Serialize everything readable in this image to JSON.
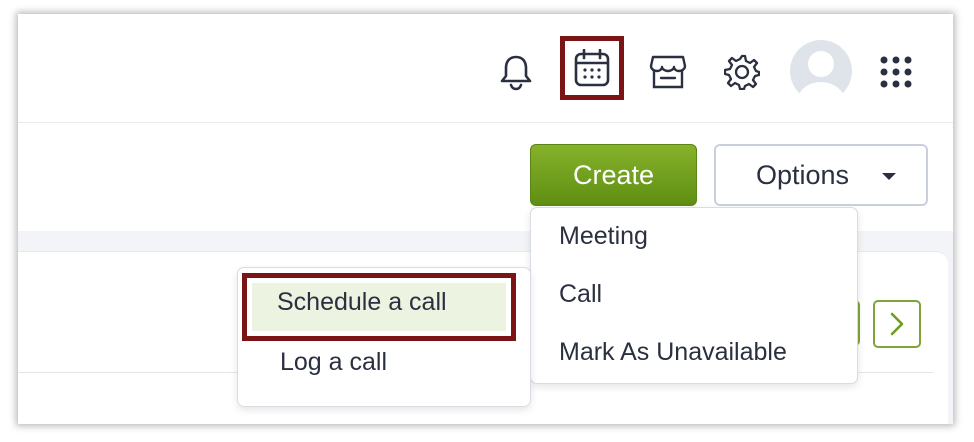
{
  "topbar": {
    "icons": [
      "bell-icon",
      "calendar-icon",
      "store-icon",
      "gear-icon",
      "avatar",
      "apps-grid-icon"
    ],
    "highlight_color": "#7b1414"
  },
  "actions": {
    "create_label": "Create",
    "options_label": "Options",
    "create_color": "#6e9e1c"
  },
  "create_menu": {
    "items": [
      "Meeting",
      "Call",
      "Mark As Unavailable"
    ]
  },
  "call_submenu": {
    "items": [
      "Schedule a call",
      "Log a call"
    ],
    "selected_bg": "#edf3e1"
  }
}
